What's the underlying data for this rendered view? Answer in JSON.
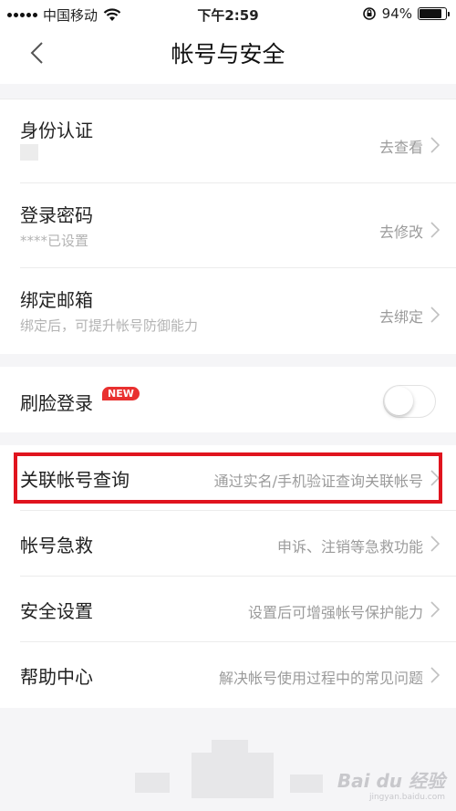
{
  "status_bar": {
    "carrier": "中国移动",
    "time": "下午2:59",
    "battery_percent": "94%",
    "battery_level": 0.94
  },
  "nav": {
    "title": "帐号与安全",
    "back_icon": "chevron-left-icon"
  },
  "security": {
    "identity": {
      "label": "身份认证",
      "action": "去查看"
    },
    "password": {
      "label": "登录密码",
      "status": "****已设置",
      "action": "去修改"
    },
    "email": {
      "label": "绑定邮箱",
      "hint": "绑定后，可提升帐号防御能力",
      "action": "去绑定"
    }
  },
  "face_login": {
    "label": "刷脸登录",
    "badge": "NEW",
    "enabled": false
  },
  "menu": [
    {
      "label": "关联帐号查询",
      "hint": "通过实名/手机验证查询关联帐号"
    },
    {
      "label": "帐号急救",
      "hint": "申诉、注销等急救功能"
    },
    {
      "label": "安全设置",
      "hint": "设置后可增强帐号保护能力"
    },
    {
      "label": "帮助中心",
      "hint": "解决帐号使用过程中的常见问题"
    }
  ],
  "watermark": {
    "brand": "Bai du 经验",
    "url": "jingyan.baidu.com"
  },
  "colors": {
    "highlight": "#e0141e",
    "badge": "#e9302f",
    "hint": "#9b9b9b"
  }
}
